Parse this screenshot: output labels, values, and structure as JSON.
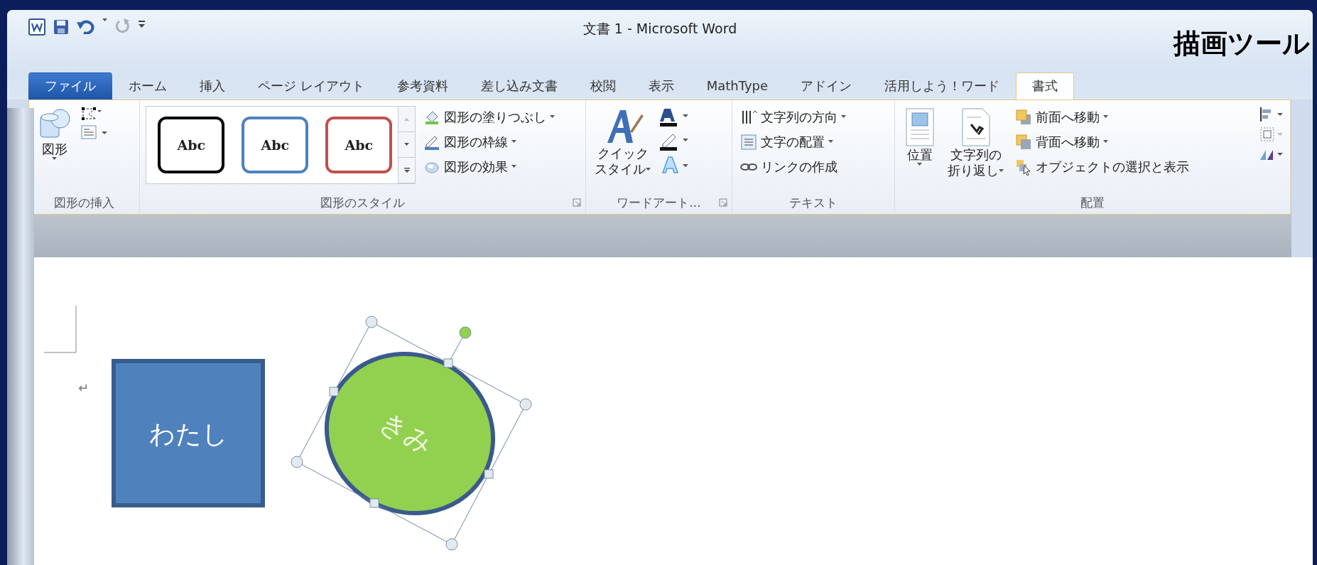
{
  "window": {
    "title": "文書 1 - Microsoft Word",
    "contextual_label": "描画ツール"
  },
  "tabs": [
    {
      "label": "ファイル",
      "kind": "file",
      "selected": false
    },
    {
      "label": "ホーム",
      "kind": "tab",
      "selected": false
    },
    {
      "label": "挿入",
      "kind": "tab",
      "selected": false
    },
    {
      "label": "ページ レイアウト",
      "kind": "tab",
      "selected": false
    },
    {
      "label": "参考資料",
      "kind": "tab",
      "selected": false
    },
    {
      "label": "差し込み文書",
      "kind": "tab",
      "selected": false
    },
    {
      "label": "校閲",
      "kind": "tab",
      "selected": false
    },
    {
      "label": "表示",
      "kind": "tab",
      "selected": false
    },
    {
      "label": "MathType",
      "kind": "tab",
      "selected": false
    },
    {
      "label": "アドイン",
      "kind": "tab",
      "selected": false
    },
    {
      "label": "活用しよう！ワード",
      "kind": "tab",
      "selected": false
    },
    {
      "label": "書式",
      "kind": "tab",
      "selected": true
    }
  ],
  "ribbon": {
    "insert_shapes": {
      "label": "図形の挿入",
      "shapes_button": "図形"
    },
    "shape_styles": {
      "label": "図形のスタイル",
      "gallery": [
        {
          "text": "Abc",
          "color": "#000000"
        },
        {
          "text": "Abc",
          "color": "#4f81bd"
        },
        {
          "text": "Abc",
          "color": "#c0504d"
        }
      ],
      "commands": [
        "図形の塗りつぶし",
        "図形の枠線",
        "図形の効果"
      ]
    },
    "wordart": {
      "label": "ワードアート...",
      "quick_style": [
        "クイック",
        "スタイル"
      ]
    },
    "text": {
      "label": "テキスト",
      "commands": [
        "文字列の方向",
        "文字の配置",
        "リンクの作成"
      ]
    },
    "arrange": {
      "label": "配置",
      "position": "位置",
      "wrap": [
        "文字列の",
        "折り返し"
      ],
      "commands": [
        "前面へ移動",
        "背面へ移動",
        "オブジェクトの選択と表示"
      ]
    }
  },
  "document": {
    "paragraph_mark": "↵",
    "shapes": [
      {
        "kind": "square",
        "text": "わたし",
        "selected": false
      },
      {
        "kind": "circle",
        "text": "きみ",
        "selected": true
      }
    ]
  }
}
